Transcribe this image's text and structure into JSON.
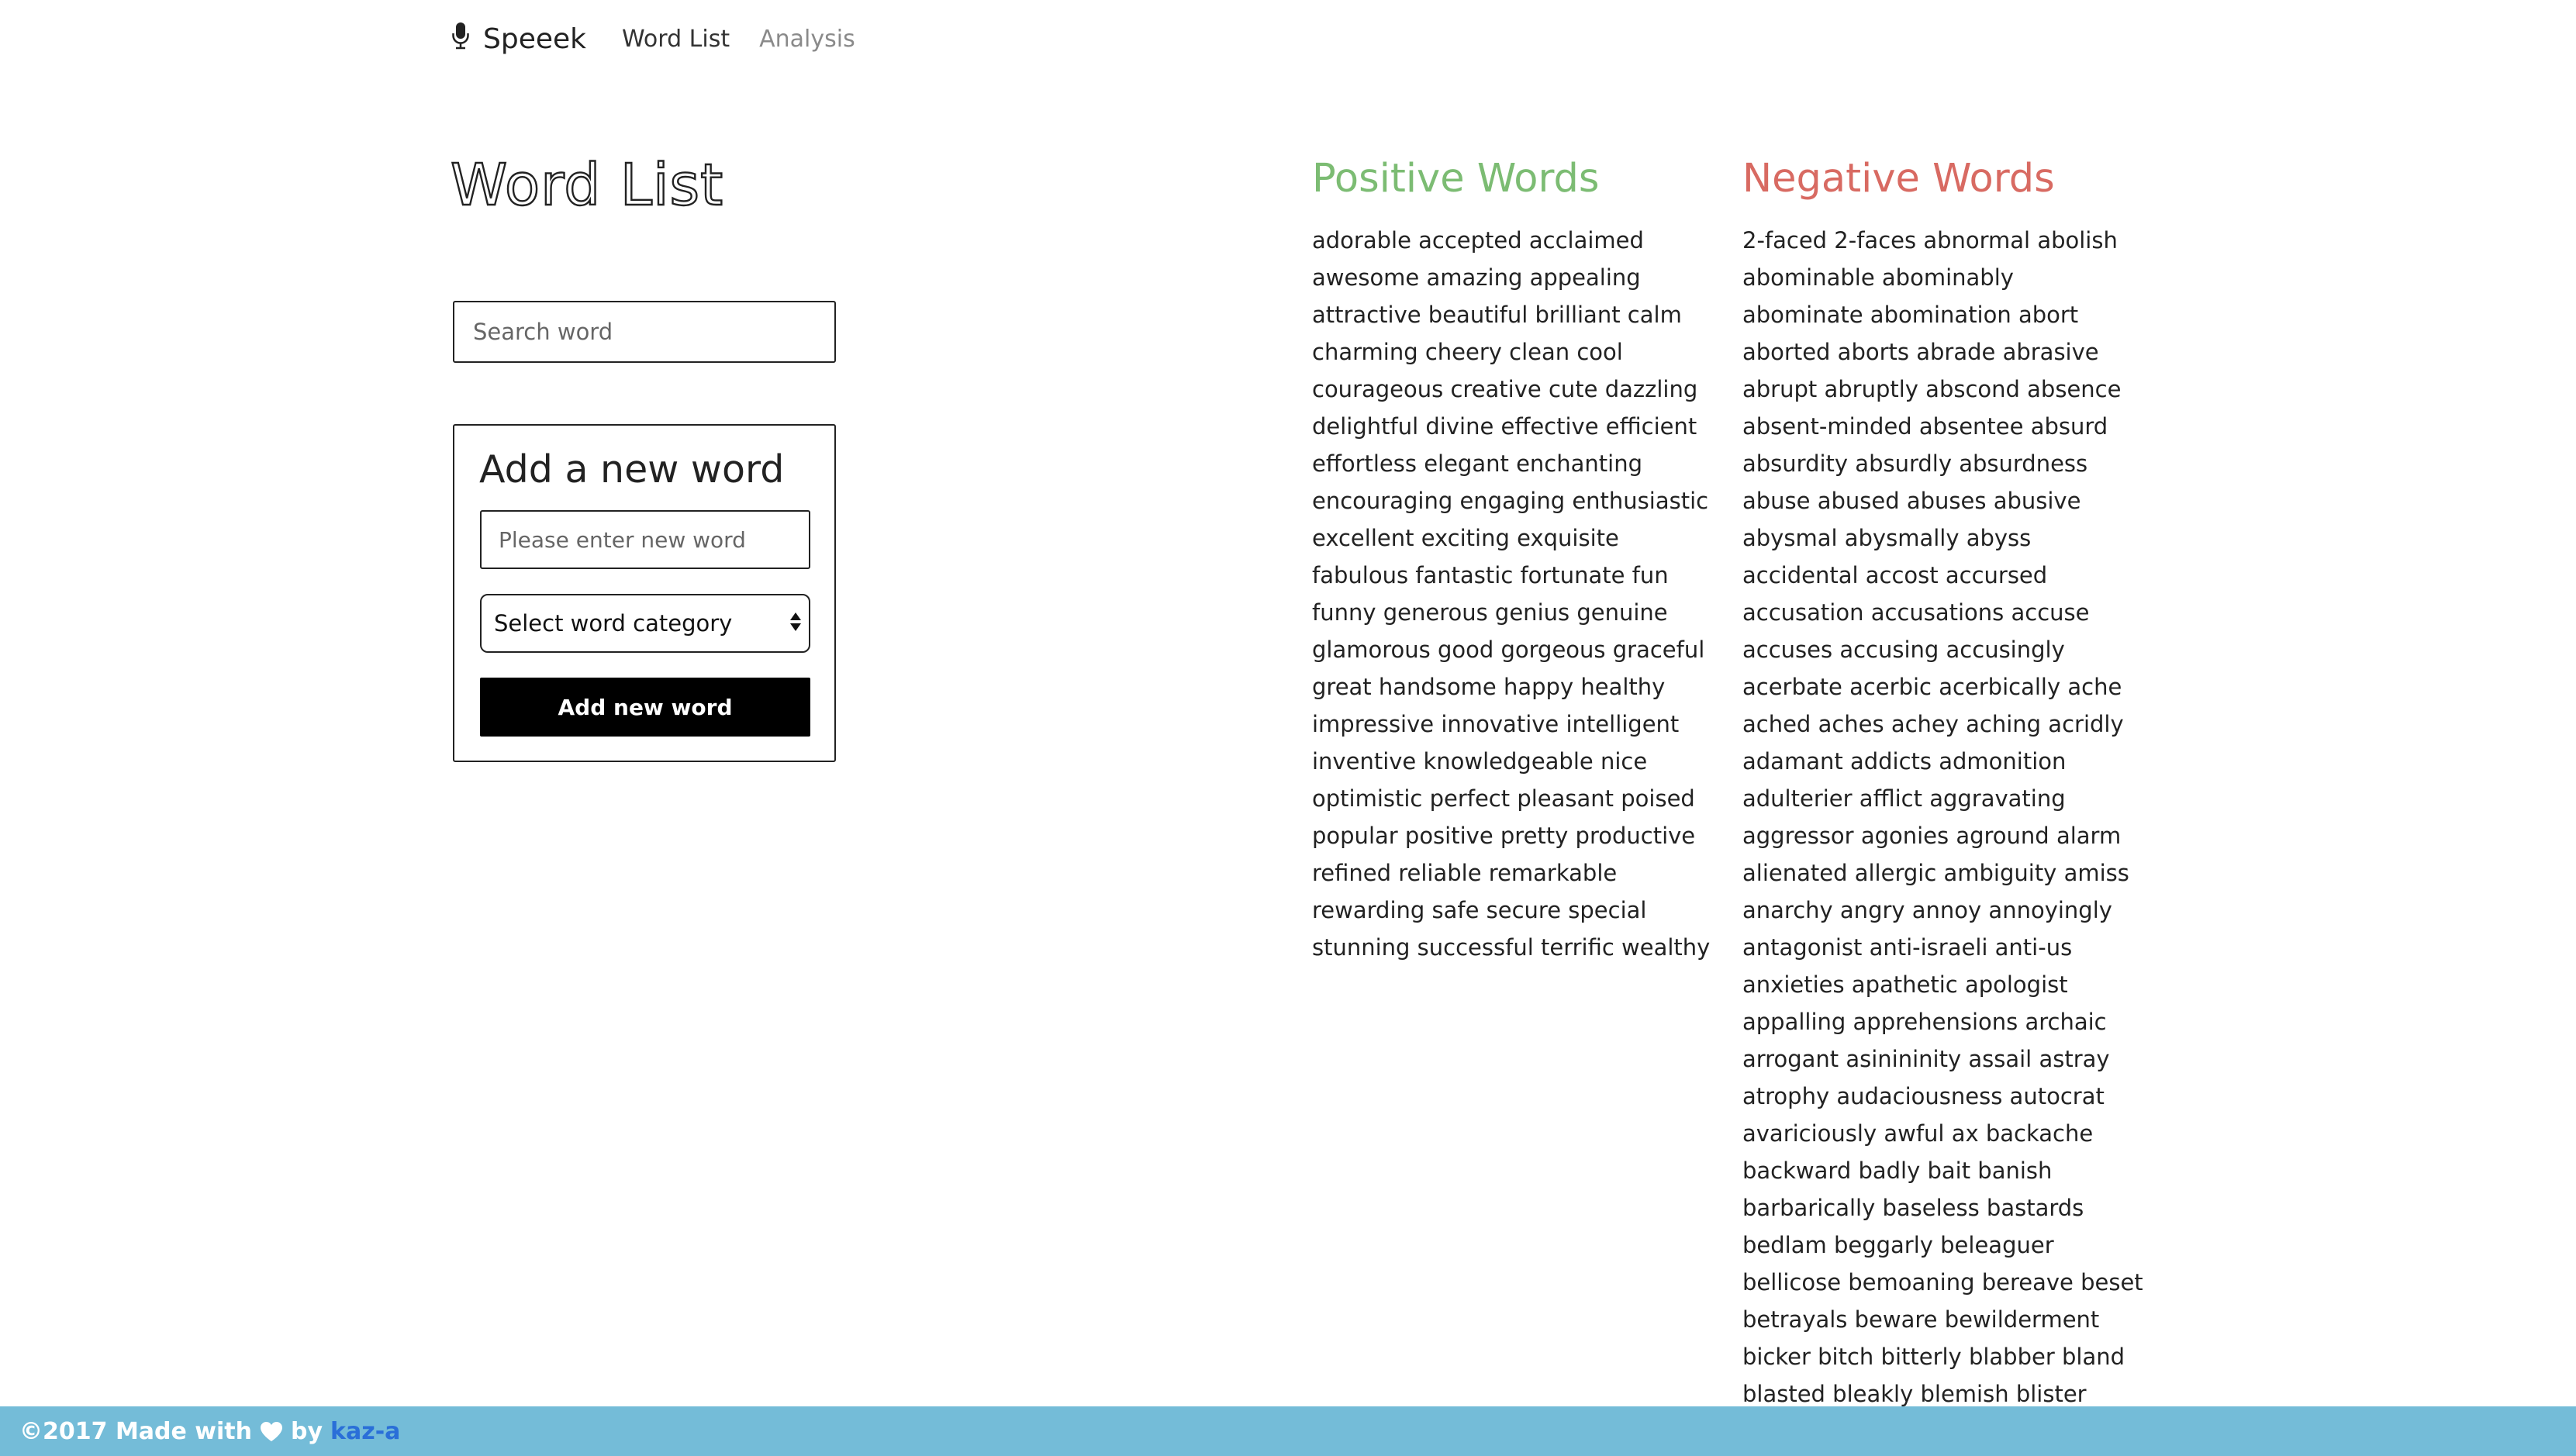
{
  "nav": {
    "brand": "Speeek",
    "brand_icon": "microphone-icon",
    "links": [
      {
        "label": "Word List",
        "state": "active"
      },
      {
        "label": "Analysis",
        "state": "inactive"
      }
    ]
  },
  "main": {
    "title": "Word List",
    "search": {
      "placeholder": "Search word",
      "value": ""
    },
    "add_panel": {
      "title": "Add a new word",
      "word_input": {
        "placeholder": "Please enter new word",
        "value": ""
      },
      "category_select": {
        "selected": "Select word category"
      },
      "button_label": "Add new word"
    }
  },
  "positive": {
    "heading": "Positive Words",
    "color": "#7cbc73",
    "lines": [
      "adorable accepted acclaimed",
      "awesome amazing appealing",
      "attractive beautiful brilliant calm",
      "charming cheery clean cool",
      "courageous creative cute dazzling",
      "delightful divine effective efficient",
      "effortless elegant enchanting",
      "encouraging engaging enthusiastic",
      "excellent exciting exquisite",
      "fabulous fantastic fortunate fun",
      "funny generous genius genuine",
      "glamorous good gorgeous graceful",
      "great handsome happy healthy",
      "impressive innovative intelligent",
      "inventive knowledgeable nice",
      "optimistic perfect pleasant poised",
      "popular positive pretty productive",
      "refined reliable remarkable",
      "rewarding safe secure special",
      "stunning successful terrific wealthy"
    ]
  },
  "negative": {
    "heading": "Negative Words",
    "color": "#d86a62",
    "lines": [
      "2-faced 2-faces abnormal abolish",
      "abominable abominably",
      "abominate abomination abort",
      "aborted aborts abrade abrasive",
      "abrupt abruptly abscond absence",
      "absent-minded absentee absurd",
      "absurdity absurdly absurdness",
      "abuse abused abuses abusive",
      "abysmal abysmally abyss",
      "accidental accost accursed",
      "accusation accusations accuse",
      "accuses accusing accusingly",
      "acerbate acerbic acerbically ache",
      "ached aches achey aching acridly",
      "adamant addicts admonition",
      "adulterier afflict aggravating",
      "aggressor agonies aground alarm",
      "alienated allergic ambiguity amiss",
      "anarchy angry annoy annoyingly",
      "antagonist anti-israeli anti-us",
      "anxieties apathetic apologist",
      "appalling apprehensions archaic",
      "arrogant asinininity assail astray",
      "atrophy audaciousness autocrat",
      "avariciously awful ax backache",
      "backward badly bait banish",
      "barbarically baseless bastards",
      "bedlam beggarly beleaguer",
      "bellicose bemoaning bereave beset",
      "betrayals beware bewilderment",
      "bicker bitch bitterly blabber bland",
      "blasted bleakly blemish blister"
    ]
  },
  "footer": {
    "prefix": "©2017 Made with",
    "heart_icon": "heart-icon",
    "by": "by",
    "author": "kaz-a",
    "background": "#74bcd8"
  }
}
